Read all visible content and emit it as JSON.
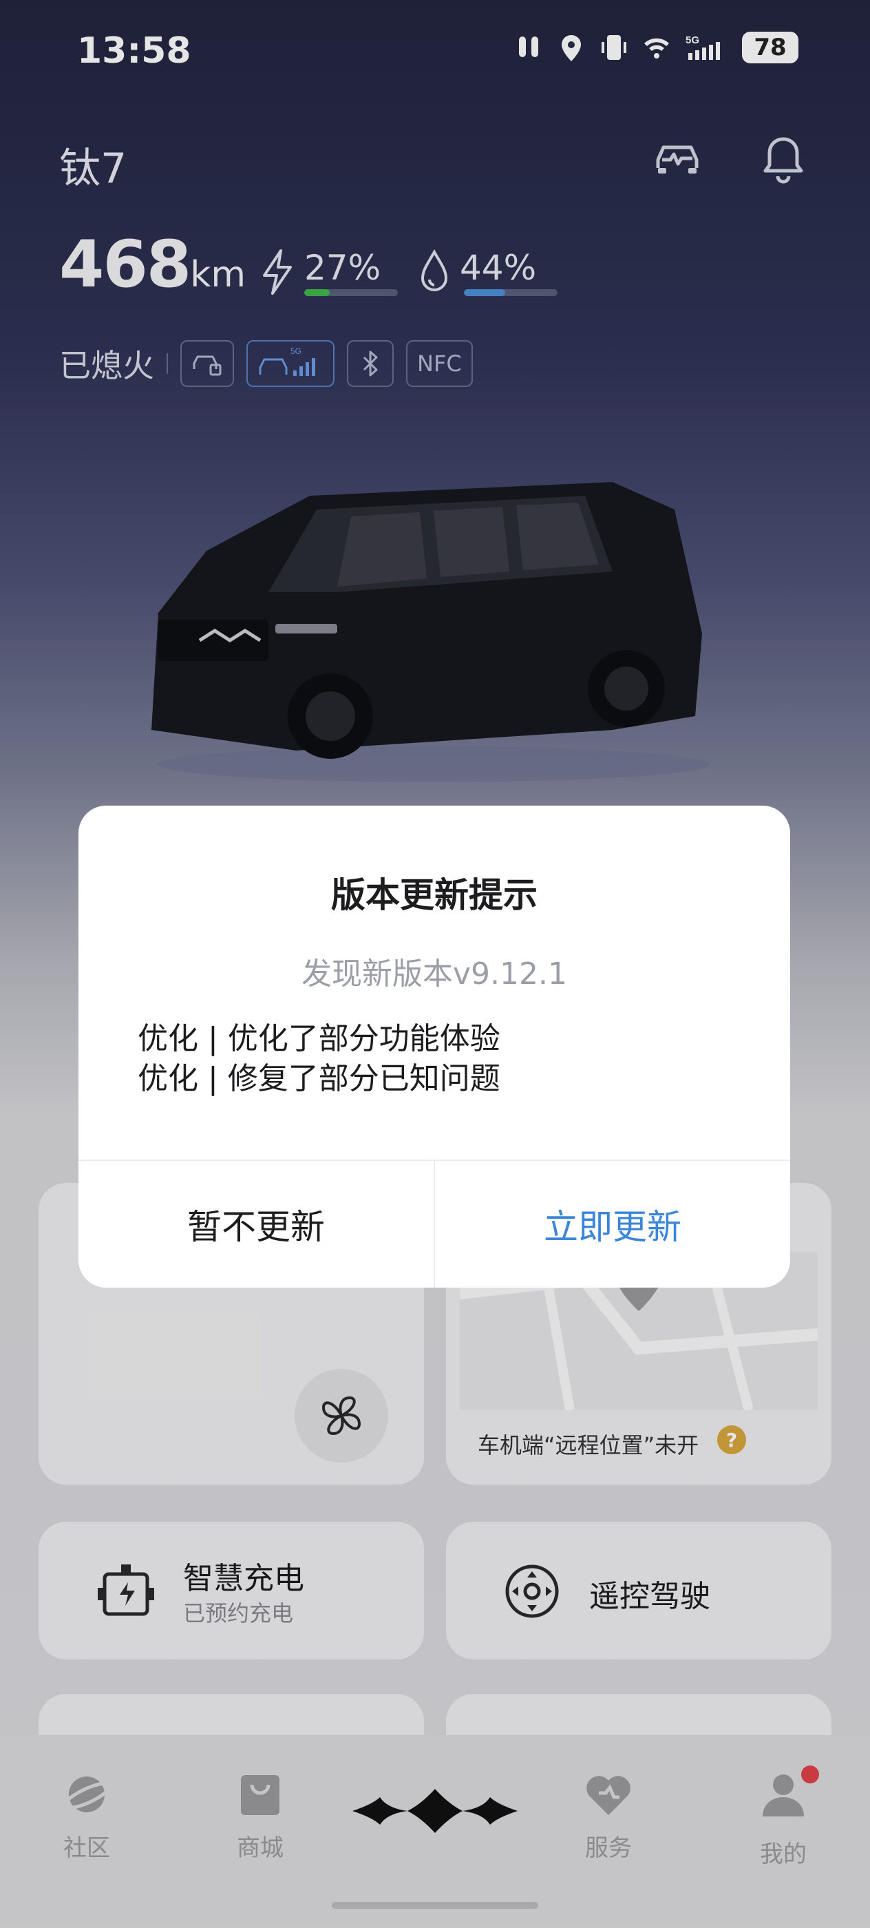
{
  "status_bar": {
    "time": "13:58",
    "battery": "78",
    "network": "5G"
  },
  "vehicle": {
    "name": "钛7",
    "range_value": "468",
    "range_unit": "km",
    "battery_pct": "27%",
    "battery_fraction": 0.27,
    "fuel_pct": "44%",
    "fuel_fraction": 0.44,
    "engine_state": "已熄火",
    "nfc_label": "NFC"
  },
  "cards": {
    "location_note": "车机端“远程位置”未开",
    "smart_charge_title": "智慧充电",
    "smart_charge_sub": "已预约充电",
    "remote_drive": "遥控驾驶"
  },
  "bottom_nav": [
    {
      "label": "社区",
      "icon": "planet-icon"
    },
    {
      "label": "商城",
      "icon": "shopping-bag-icon"
    },
    {
      "label": "",
      "icon": "brand-logo-icon"
    },
    {
      "label": "服务",
      "icon": "service-icon"
    },
    {
      "label": "我的",
      "icon": "user-icon"
    }
  ],
  "dialog": {
    "title": "版本更新提示",
    "version": "发现新版本v9.12.1",
    "notes": [
      "优化 | 优化了部分功能体验",
      "优化 | 修复了部分已知问题"
    ],
    "cancel": "暂不更新",
    "confirm": "立即更新"
  },
  "colors": {
    "accent_blue": "#3b86d9",
    "battery_green": "#3fb84a",
    "fuel_blue": "#4b90d6",
    "badge_red": "#e0414a"
  }
}
